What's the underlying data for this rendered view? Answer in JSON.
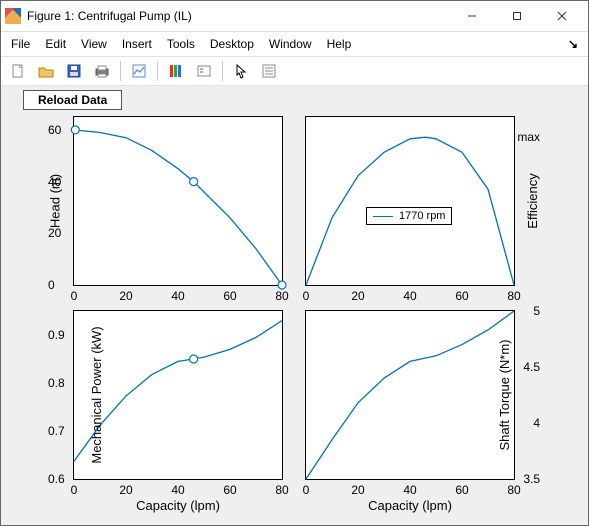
{
  "window": {
    "title": "Figure 1: Centrifugal Pump (IL)"
  },
  "menus": {
    "file": "File",
    "edit": "Edit",
    "view": "View",
    "insert": "Insert",
    "tools": "Tools",
    "desktop": "Desktop",
    "window": "Window",
    "help": "Help",
    "restore_glyph": "↘"
  },
  "toolbar_icons": {
    "new": "New Figure",
    "open": "Open",
    "save": "Save",
    "print": "Print",
    "datacursor": "Data Cursor",
    "colorbar": "Colorbar",
    "legend": "Legend",
    "pointer": "Pointer",
    "props": "Plot Properties"
  },
  "buttons": {
    "reload": "Reload Data"
  },
  "axes": {
    "tl": {
      "ylabel": "Head (m)",
      "xticks": [
        "0",
        "20",
        "40",
        "60",
        "80"
      ],
      "yticks": [
        "0",
        "20",
        "40",
        "60"
      ]
    },
    "tr": {
      "ylabel": "Efficiency",
      "xticks": [
        "0",
        "20",
        "40",
        "60",
        "80"
      ],
      "ytick_text": "max"
    },
    "bl": {
      "ylabel": "Mechanical Power (kW)",
      "xlabel": "Capacity (lpm)",
      "xticks": [
        "0",
        "20",
        "40",
        "60",
        "80"
      ],
      "yticks": [
        "0.6",
        "0.7",
        "0.8",
        "0.9"
      ]
    },
    "br": {
      "ylabel": "Shaft Torque (N*m)",
      "xlabel": "Capacity (lpm)",
      "xticks": [
        "0",
        "20",
        "40",
        "60",
        "80"
      ],
      "yticks": [
        "3.5",
        "4",
        "4.5",
        "5"
      ]
    }
  },
  "legend": {
    "label": "1770 rpm"
  },
  "chart_data": [
    {
      "type": "line",
      "title": "",
      "xlabel": "",
      "ylabel": "Head (m)",
      "xlim": [
        0,
        80
      ],
      "ylim": [
        0,
        65
      ],
      "x": [
        0,
        10,
        20,
        30,
        40,
        46,
        50,
        60,
        70,
        80
      ],
      "values": [
        60,
        59,
        57,
        52,
        45,
        40,
        36,
        26,
        14,
        0
      ],
      "markers_x": [
        0.5,
        46,
        80
      ],
      "markers_y": [
        60,
        40,
        0
      ]
    },
    {
      "type": "line",
      "title": "",
      "xlabel": "",
      "ylabel": "Efficiency",
      "xlim": [
        0,
        80
      ],
      "ylim": [
        0,
        1
      ],
      "x": [
        0,
        10,
        20,
        30,
        40,
        46,
        50,
        60,
        70,
        80
      ],
      "values": [
        0.0,
        0.4,
        0.65,
        0.79,
        0.87,
        0.88,
        0.87,
        0.79,
        0.57,
        0.0
      ],
      "series_name": "1770 rpm",
      "ytick_text": "max",
      "ytick_text_at": 0.88
    },
    {
      "type": "line",
      "title": "",
      "xlabel": "Capacity (lpm)",
      "ylabel": "Mechanical Power (kW)",
      "xlim": [
        0,
        80
      ],
      "ylim": [
        0.6,
        0.95
      ],
      "x": [
        0,
        10,
        20,
        30,
        40,
        46,
        50,
        60,
        70,
        80
      ],
      "values": [
        0.637,
        0.712,
        0.773,
        0.818,
        0.845,
        0.85,
        0.854,
        0.87,
        0.895,
        0.93
      ],
      "markers_x": [
        46
      ],
      "markers_y": [
        0.85
      ]
    },
    {
      "type": "line",
      "title": "",
      "xlabel": "Capacity (lpm)",
      "ylabel": "Shaft Torque (N*m)",
      "xlim": [
        0,
        80
      ],
      "ylim": [
        3.5,
        5.0
      ],
      "x": [
        0,
        10,
        20,
        30,
        40,
        46,
        50,
        60,
        70,
        80
      ],
      "values": [
        3.5,
        3.85,
        4.18,
        4.4,
        4.55,
        4.58,
        4.6,
        4.7,
        4.83,
        5.0
      ]
    }
  ]
}
